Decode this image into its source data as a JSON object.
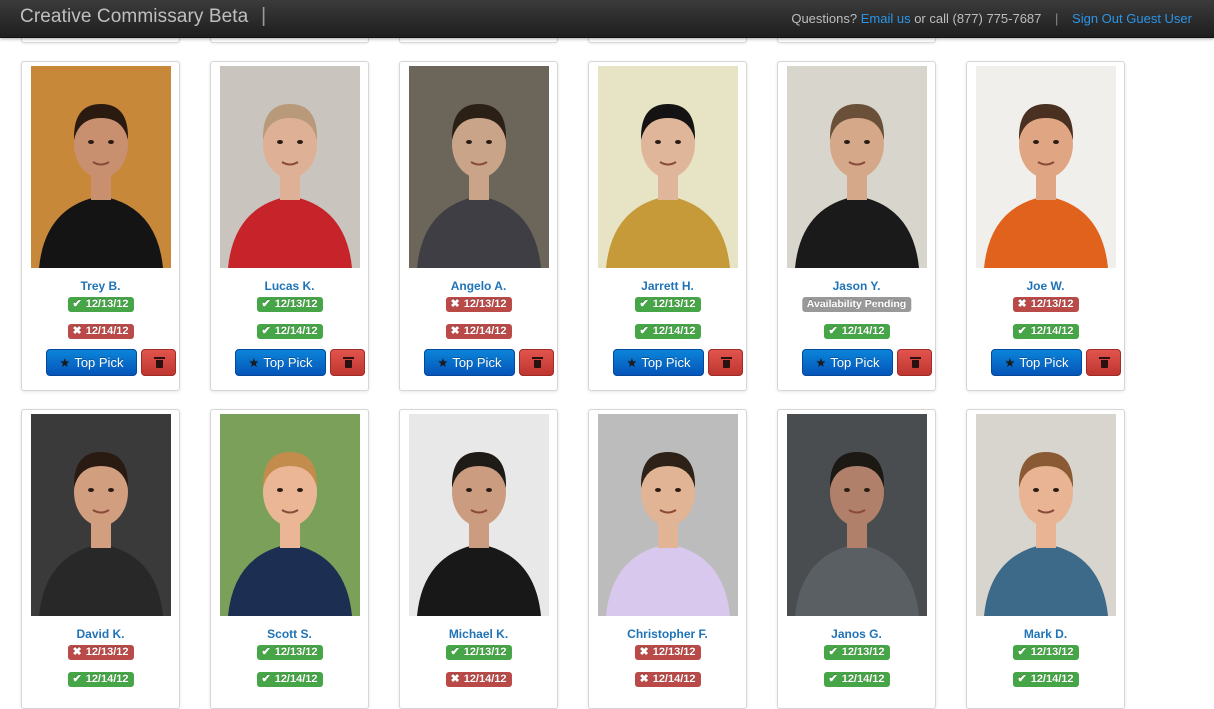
{
  "header": {
    "brand": "Creative Commissary Beta",
    "divider": "|",
    "questions_text": "Questions?",
    "email_link": "Email us",
    "call_text": "or call (877) 775-7687",
    "separator": "|",
    "signout_link": "Sign Out Guest User"
  },
  "buttons": {
    "top_pick_label": "Top Pick",
    "top_pick_icon": "star-icon",
    "delete_icon": "trash-icon"
  },
  "colors": {
    "confirmed": "#46a546",
    "declined": "#b94a48",
    "pending": "#999999",
    "primary_button": "#0555b8",
    "danger_button": "#bd362f",
    "link": "#1f73b7"
  },
  "talent": [
    {
      "name": "Trey B.",
      "photo": {
        "bg": "#c8883a",
        "hair": "#2a1a10",
        "skin": "#c99070",
        "shirt": "#141414"
      },
      "dates": [
        {
          "label": "12/13/12",
          "status": "confirmed"
        },
        {
          "label": "12/14/12",
          "status": "declined"
        }
      ]
    },
    {
      "name": "Lucas K.",
      "photo": {
        "bg": "#c9c4bd",
        "hair": "#b89a7a",
        "skin": "#deb096",
        "shirt": "#c7232a"
      },
      "dates": [
        {
          "label": "12/13/12",
          "status": "confirmed"
        },
        {
          "label": "12/14/12",
          "status": "confirmed"
        }
      ]
    },
    {
      "name": "Angelo A.",
      "photo": {
        "bg": "#6c655a",
        "hair": "#2b2016",
        "skin": "#caa488",
        "shirt": "#3e3e44"
      },
      "dates": [
        {
          "label": "12/13/12",
          "status": "declined"
        },
        {
          "label": "12/14/12",
          "status": "declined"
        }
      ]
    },
    {
      "name": "Jarrett H.",
      "photo": {
        "bg": "#e6e4c4",
        "hair": "#141212",
        "skin": "#e0b69a",
        "shirt": "#c69a38"
      },
      "dates": [
        {
          "label": "12/13/12",
          "status": "confirmed"
        },
        {
          "label": "12/14/12",
          "status": "confirmed"
        }
      ]
    },
    {
      "name": "Jason Y.",
      "photo": {
        "bg": "#d8d6cc",
        "hair": "#6a5038",
        "skin": "#d6a88a",
        "shirt": "#1a1a1a"
      },
      "dates": [
        {
          "label": "Availability Pending",
          "status": "pending"
        },
        {
          "label": "12/14/12",
          "status": "confirmed"
        }
      ]
    },
    {
      "name": "Joe W.",
      "photo": {
        "bg": "#f1efec",
        "hair": "#4a3020",
        "skin": "#e0a684",
        "shirt": "#e0621c"
      },
      "dates": [
        {
          "label": "12/13/12",
          "status": "declined"
        },
        {
          "label": "12/14/12",
          "status": "confirmed"
        }
      ]
    },
    {
      "name": "David K.",
      "photo": {
        "bg": "#3a3a3a",
        "hair": "#2a1b12",
        "skin": "#d29e80",
        "shirt": "#282828"
      },
      "dates": [
        {
          "label": "12/13/12",
          "status": "declined"
        },
        {
          "label": "12/14/12",
          "status": "confirmed"
        }
      ]
    },
    {
      "name": "Scott S.",
      "photo": {
        "bg": "#7aa05a",
        "hair": "#c48c4c",
        "skin": "#eab696",
        "shirt": "#1c2f52"
      },
      "dates": [
        {
          "label": "12/13/12",
          "status": "confirmed"
        },
        {
          "label": "12/14/12",
          "status": "confirmed"
        }
      ]
    },
    {
      "name": "Michael K.",
      "photo": {
        "bg": "#e8e8e8",
        "hair": "#1e1a16",
        "skin": "#cc9c80",
        "shirt": "#181818"
      },
      "dates": [
        {
          "label": "12/13/12",
          "status": "confirmed"
        },
        {
          "label": "12/14/12",
          "status": "declined"
        }
      ]
    },
    {
      "name": "Christopher F.",
      "photo": {
        "bg": "#bcbcbc",
        "hair": "#2e2218",
        "skin": "#e0b494",
        "shirt": "#d8c8ee"
      },
      "dates": [
        {
          "label": "12/13/12",
          "status": "declined"
        },
        {
          "label": "12/14/12",
          "status": "declined"
        }
      ]
    },
    {
      "name": "Janos G.",
      "photo": {
        "bg": "#4a4d50",
        "hair": "#1c1814",
        "skin": "#b0806a",
        "shirt": "#5a5f64"
      },
      "dates": [
        {
          "label": "12/13/12",
          "status": "confirmed"
        },
        {
          "label": "12/14/12",
          "status": "confirmed"
        }
      ]
    },
    {
      "name": "Mark D.",
      "photo": {
        "bg": "#d8d4ce",
        "hair": "#8a5a34",
        "skin": "#e8b494",
        "shirt": "#3d6a88"
      },
      "dates": [
        {
          "label": "12/13/12",
          "status": "confirmed"
        },
        {
          "label": "12/14/12",
          "status": "confirmed"
        }
      ]
    }
  ]
}
